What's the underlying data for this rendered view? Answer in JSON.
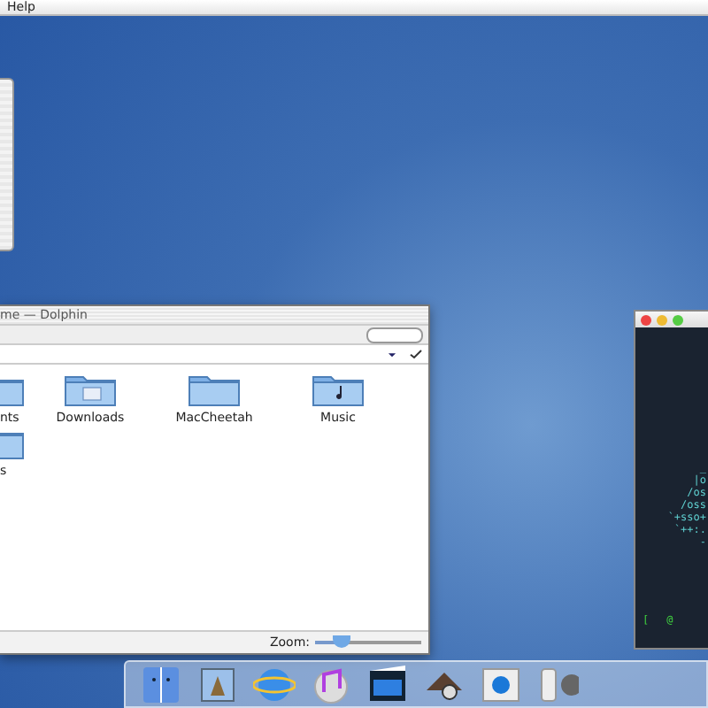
{
  "menu_bar": {
    "items": [
      "Help"
    ]
  },
  "file_manager": {
    "title": "me — Dolphin",
    "files": [
      {
        "name": "nts",
        "kind": "folder"
      },
      {
        "name": "Downloads",
        "kind": "downloads"
      },
      {
        "name": "MacCheetah",
        "kind": "folder"
      },
      {
        "name": "Music",
        "kind": "music"
      },
      {
        "name": "s",
        "kind": "folder"
      }
    ],
    "zoom": {
      "label": "Zoom:",
      "level": 0.25
    }
  },
  "terminal": {
    "lines": [
      "_",
      "|o",
      "/os",
      "/oss",
      "`+sso+",
      "`++:.",
      "-"
    ],
    "prompt": [
      "[",
      "@"
    ]
  }
}
